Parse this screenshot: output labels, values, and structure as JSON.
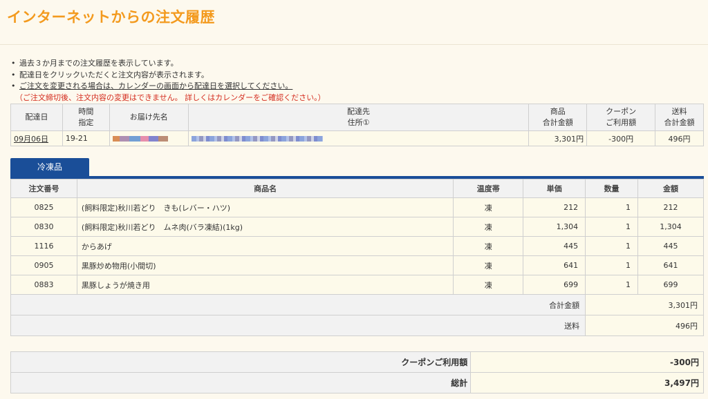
{
  "page": {
    "title": "インターネットからの注文履歴"
  },
  "notes": {
    "items": [
      "過去３か月までの注文履歴を表示しています。",
      "配達日をクリックいただくと注文内容が表示されます。",
      "ご注文を変更される場合は、カレンダーの画面から配達日を選択してください。"
    ],
    "warning": "（ご注文締切後、注文内容の変更はできません。 詳しくはカレンダーをご確認ください。）"
  },
  "summary": {
    "headers": {
      "date": "配達日",
      "time_1": "時間",
      "time_2": "指定",
      "recipient": "お届け先名",
      "address_1": "配達先",
      "address_2": "住所①",
      "goods_1": "商品",
      "goods_2": "合計金額",
      "coupon_1": "クーポン",
      "coupon_2": "ご利用額",
      "shipping_1": "送料",
      "shipping_2": "合計金額"
    },
    "row": {
      "date": "09月06日",
      "time": "19-21",
      "goods_total": "3,301円",
      "coupon": "-300円",
      "shipping": "496円"
    }
  },
  "tab": {
    "label": "冷凍品"
  },
  "items": {
    "headers": {
      "order_no": "注文番号",
      "product": "商品名",
      "temp": "温度帯",
      "unit_price": "単価",
      "qty": "数量",
      "amount": "金額"
    },
    "rows": [
      {
        "order_no": "0825",
        "product": "(飼料限定)秋川若どり　きも(レバー・ハツ)",
        "temp": "凍",
        "unit_price": "212",
        "qty": "1",
        "amount": "212"
      },
      {
        "order_no": "0830",
        "product": "(飼料限定)秋川若どり　ムネ肉(バラ凍結)(1kg)",
        "temp": "凍",
        "unit_price": "1,304",
        "qty": "1",
        "amount": "1,304"
      },
      {
        "order_no": "1116",
        "product": "からあげ",
        "temp": "凍",
        "unit_price": "445",
        "qty": "1",
        "amount": "445"
      },
      {
        "order_no": "0905",
        "product": "黒豚炒め物用(小間切)",
        "temp": "凍",
        "unit_price": "641",
        "qty": "1",
        "amount": "641"
      },
      {
        "order_no": "0883",
        "product": "黒豚しょうが焼き用",
        "temp": "凍",
        "unit_price": "699",
        "qty": "1",
        "amount": "699"
      }
    ],
    "subtotal_label": "合計金額",
    "subtotal_value": "3,301円",
    "shipping_label": "送料",
    "shipping_value": "496円"
  },
  "grand": {
    "coupon_label": "クーポンご利用額",
    "coupon_value": "-300円",
    "total_label": "総計",
    "total_value": "3,497円"
  }
}
